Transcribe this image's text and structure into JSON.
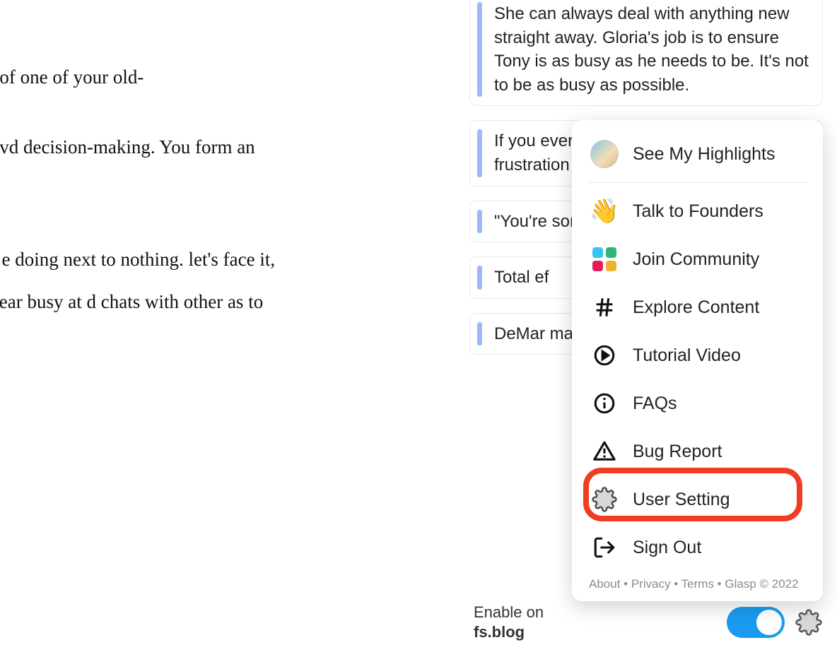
{
  "article": {
    "p1": "ined access to a time office of one of your old-",
    "p2": "vation should be enough to vd decision-making. You form an entire industry for",
    "p3": "prised to find it's far from a e doing next to nothing. let's face it, the genders She doesn't appear busy at d chats with other as to why Tony would"
  },
  "highlights": [
    "She can always deal with anything new straight away. Gloria's job is to ensure Tony is as busy as he needs to be. It's not to be as busy as possible.",
    "If you ever feel overwhelmed despite frustration to new more s",
    "\"You're somethi And yo doing t",
    "Total ef",
    "DeMar matter, everyo percent some bu"
  ],
  "menu": {
    "highlights": "See My Highlights",
    "talk": "Talk to Founders",
    "community": "Join Community",
    "explore": "Explore Content",
    "tutorial": "Tutorial Video",
    "faqs": "FAQs",
    "bug": "Bug Report",
    "settings": "User Setting",
    "signout": "Sign Out"
  },
  "footer": {
    "about": "About",
    "privacy": "Privacy",
    "terms": "Terms",
    "copyright": "Glasp © 2022",
    "sep": " • "
  },
  "enable": {
    "label": "Enable on",
    "domain": "fs.blog"
  }
}
